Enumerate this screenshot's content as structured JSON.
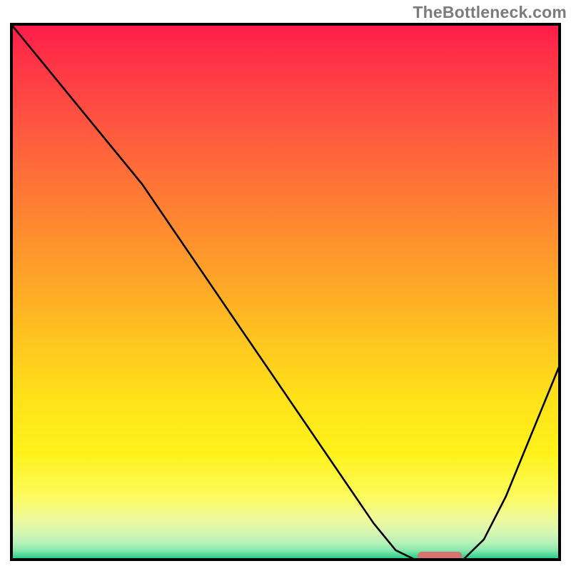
{
  "watermark": "TheBottleneck.com",
  "chart_data": {
    "type": "line",
    "title": "",
    "xlabel": "",
    "ylabel": "",
    "xlim": [
      0,
      100
    ],
    "ylim": [
      0,
      100
    ],
    "x": [
      0,
      4,
      8,
      12,
      16,
      20,
      24,
      30,
      36,
      42,
      48,
      54,
      60,
      66,
      70,
      74,
      78,
      82,
      86,
      90,
      94,
      98,
      100
    ],
    "values": [
      100,
      95,
      90,
      85,
      80,
      75,
      70,
      61,
      52,
      43,
      34,
      25,
      16,
      7,
      2,
      0,
      0,
      0,
      4,
      12,
      22,
      32,
      37
    ],
    "optimum_range_x": [
      74,
      82
    ],
    "colors": {
      "gradient_top": "#ff1a4a",
      "gradient_mid": "#ffe21a",
      "gradient_bottom": "#1bbf7a",
      "marker": "#d6736e",
      "line": "#000000"
    }
  }
}
